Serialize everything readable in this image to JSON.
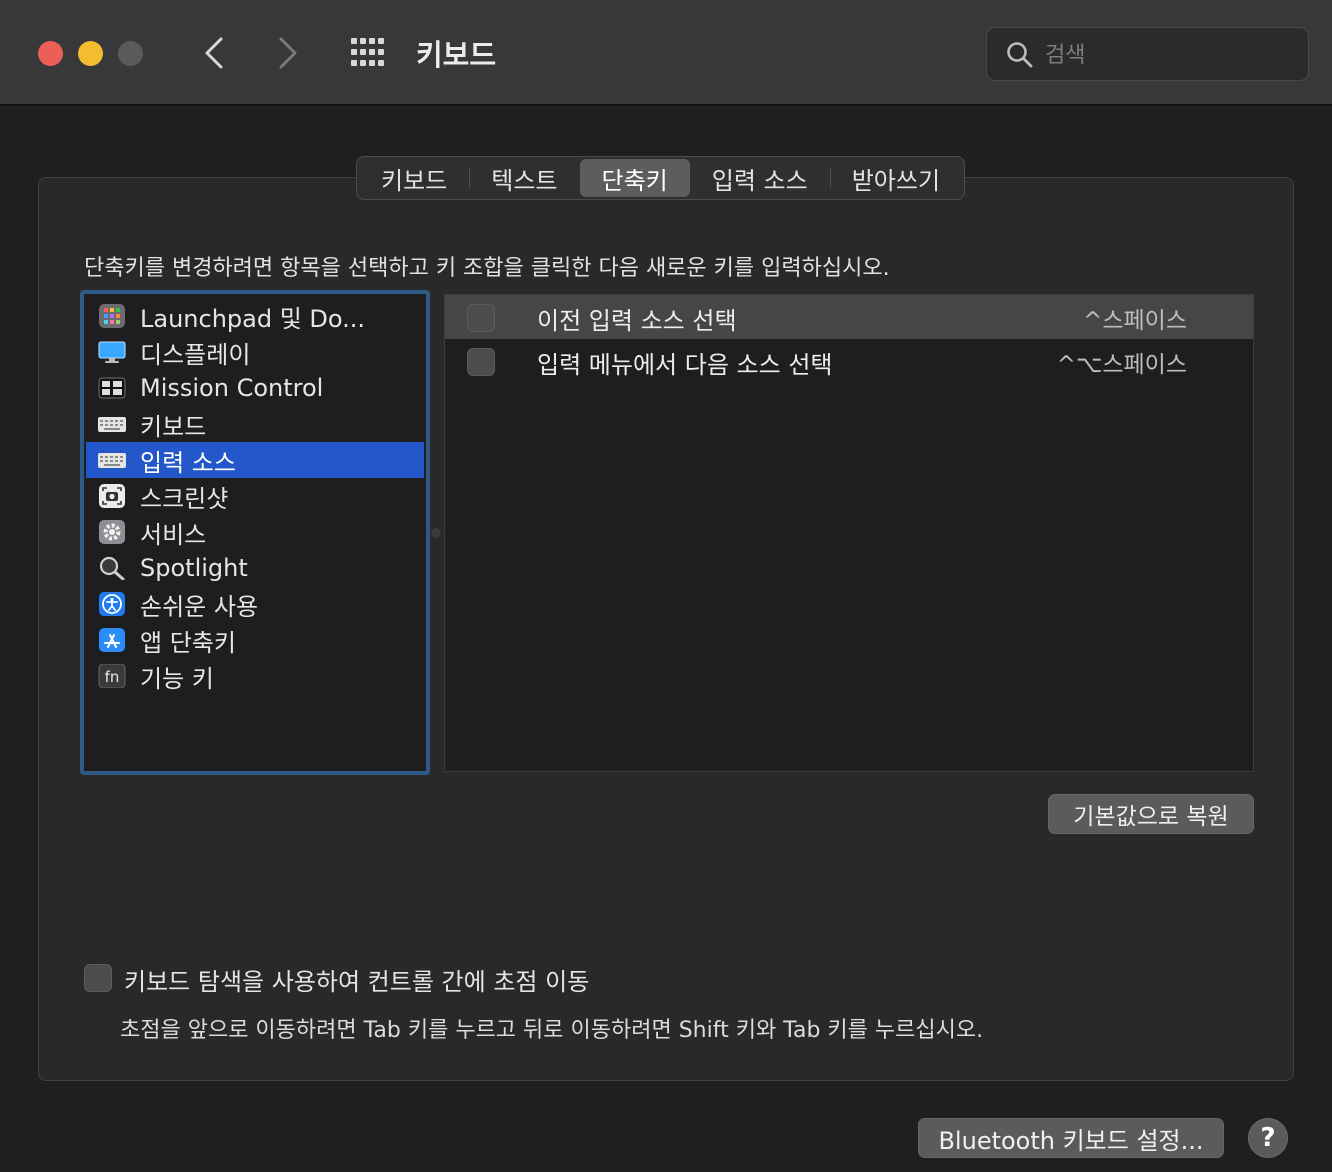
{
  "window": {
    "title": "키보드",
    "search_placeholder": "검색"
  },
  "tabs": [
    {
      "label": "키보드",
      "active": false
    },
    {
      "label": "텍스트",
      "active": false
    },
    {
      "label": "단축키",
      "active": true
    },
    {
      "label": "입력 소스",
      "active": false
    },
    {
      "label": "받아쓰기",
      "active": false
    }
  ],
  "instruction": "단축키를 변경하려면 항목을 선택하고 키 조합을 클릭한 다음 새로운 키를 입력하십시오.",
  "categories": [
    {
      "label": "Launchpad 및 Do...",
      "icon": "launchpad-icon"
    },
    {
      "label": "디스플레이",
      "icon": "display-icon"
    },
    {
      "label": "Mission Control",
      "icon": "mission-control-icon"
    },
    {
      "label": "키보드",
      "icon": "keyboard-icon"
    },
    {
      "label": "입력 소스",
      "icon": "keyboard-icon",
      "selected": true
    },
    {
      "label": "스크린샷",
      "icon": "screenshot-icon"
    },
    {
      "label": "서비스",
      "icon": "services-gear-icon"
    },
    {
      "label": "Spotlight",
      "icon": "spotlight-magnifier-icon"
    },
    {
      "label": "손쉬운 사용",
      "icon": "accessibility-icon"
    },
    {
      "label": "앱 단축키",
      "icon": "app-store-icon"
    },
    {
      "label": "기능 키",
      "icon": "fn-key-icon",
      "icon_text": "fn"
    }
  ],
  "shortcuts": [
    {
      "label": "이전 입력 소스 선택",
      "keys": "^스페이스",
      "checked": false
    },
    {
      "label": "입력 메뉴에서 다음 소스 선택",
      "keys": "^⌥스페이스",
      "checked": false
    }
  ],
  "restore_button": "기본값으로 복원",
  "keyboard_navigation": {
    "label": "키보드 탐색을 사용하여 컨트롤 간에 초점 이동",
    "description": "초점을 앞으로 이동하려면 Tab 키를 누르고 뒤로 이동하려면 Shift 키와 Tab 키를 누르십시오.",
    "checked": false
  },
  "bluetooth_button": "Bluetooth 키보드 설정...",
  "help_button": "?"
}
